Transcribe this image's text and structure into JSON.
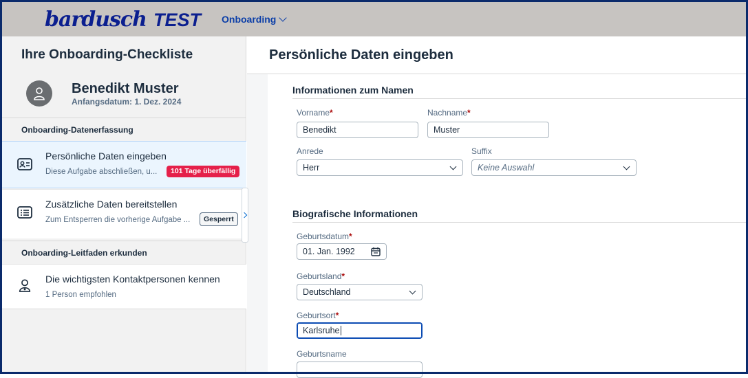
{
  "header": {
    "logo_script": "bardusch",
    "logo_env": "TEST",
    "menu_label": "Onboarding"
  },
  "sidebar": {
    "title": "Ihre Onboarding-Checkliste",
    "profile": {
      "name": "Benedikt Muster",
      "start_date": "Anfangsdatum: 1. Dez. 2024"
    },
    "groups": [
      {
        "title": "Onboarding-Datenerfassung",
        "tasks": [
          {
            "title": "Persönliche Daten eingeben",
            "subtitle": "Diese Aufgabe abschließen, u...",
            "badge": "101 Tage überfällig",
            "icon": "id-card-icon"
          },
          {
            "title": "Zusätzliche Daten bereitstellen",
            "subtitle": "Zum Entsperren die vorherige Aufgabe ...",
            "badge": "Gesperrt",
            "icon": "id-card-list-icon"
          }
        ]
      },
      {
        "title": "Onboarding-Leitfaden erkunden",
        "tasks": [
          {
            "title": "Die wichtigsten Kontaktpersonen kennen",
            "subtitle": "1 Person empfohlen",
            "icon": "contact-person-icon"
          }
        ]
      }
    ]
  },
  "main": {
    "page_title": "Persönliche Daten eingeben",
    "name_section": {
      "title": "Informationen zum Namen",
      "first_name": {
        "label": "Vorname",
        "value": "Benedikt"
      },
      "last_name": {
        "label": "Nachname",
        "value": "Muster"
      },
      "salutation": {
        "label": "Anrede",
        "value": "Herr"
      },
      "suffix": {
        "label": "Suffix",
        "placeholder": "Keine Auswahl"
      }
    },
    "bio_section": {
      "title": "Biografische Informationen",
      "birth_date": {
        "label": "Geburtsdatum",
        "value": "01. Jan. 1992"
      },
      "birth_country": {
        "label": "Geburtsland",
        "value": "Deutschland"
      },
      "birth_place": {
        "label": "Geburtsort",
        "value": "Karlsruhe"
      },
      "birth_name": {
        "label": "Geburtsname",
        "value": ""
      }
    },
    "required_marker": "*"
  },
  "colors": {
    "accent": "#0a6ed1",
    "logo": "#0b1f8f",
    "overdue": "#e5204a",
    "required": "#aa0808",
    "header_bg": "#c7c4c1"
  }
}
